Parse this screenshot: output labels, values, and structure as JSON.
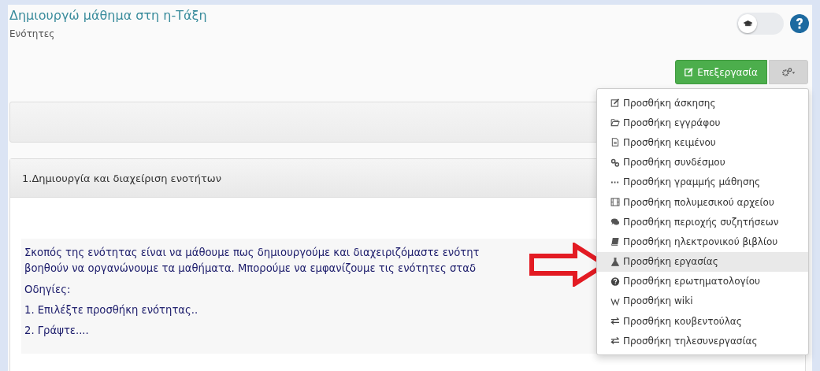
{
  "header": {
    "title": "Δημιουργώ μάθημα στη η-Τάξη",
    "subtitle": "Ενότητες"
  },
  "student_view_toggle": {
    "on": false
  },
  "toolbar": {
    "edit_button": "Επεξεργασία"
  },
  "actions_menu": {
    "expanded": true,
    "items": [
      {
        "kind": "edit",
        "label": "Προσθήκη άσκησης",
        "selected": false
      },
      {
        "kind": "folder",
        "label": "Προσθήκη εγγράφου",
        "selected": false
      },
      {
        "kind": "file",
        "label": "Προσθήκη κειμένου",
        "selected": false
      },
      {
        "kind": "link",
        "label": "Προσθήκη συνδέσμου",
        "selected": false
      },
      {
        "kind": "dots",
        "label": "Προσθήκη γραμμής μάθησης",
        "selected": false
      },
      {
        "kind": "film",
        "label": "Προσθήκη πολυμεσικού αρχείου",
        "selected": false
      },
      {
        "kind": "comments",
        "label": "Προσθήκη περιοχής συζητήσεων",
        "selected": false
      },
      {
        "kind": "book",
        "label": "Προσθήκη ηλεκτρονικού βιβλίου",
        "selected": false
      },
      {
        "kind": "flask",
        "label": "Προσθήκη εργασίας",
        "selected": true
      },
      {
        "kind": "question",
        "label": "Προσθήκη ερωτηματολογίου",
        "selected": false
      },
      {
        "kind": "wiki",
        "label": "Προσθήκη wiki",
        "selected": false
      },
      {
        "kind": "exchange",
        "label": "Προσθήκη κουβεντούλας",
        "selected": false
      },
      {
        "kind": "exchange",
        "label": "Προσθήκη τηλεσυνεργασίας",
        "selected": false
      }
    ]
  },
  "section": {
    "title": "1.Δημιουργία και διαχείριση ενοτήτων",
    "description_lines": [
      "Σκοπός της ενότητας είναι να μάθουμε πως δημιουργούμε και διαχειριζόμαστε ενότητ",
      "βοηθούν να οργανώνουμε τα μαθήματα. Μπορούμε να εμφανίζουμε τις ενότητες σταδ"
    ],
    "paragraphs": [
      "Οδηγίες:",
      "1. Επιλέξτε προσθήκη ενότητας..",
      "2. Γράψτε...."
    ]
  }
}
